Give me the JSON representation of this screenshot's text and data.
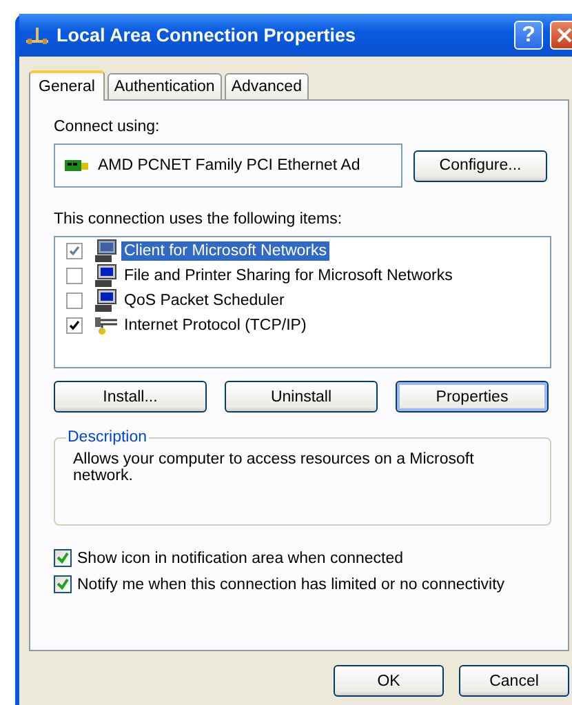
{
  "window": {
    "title": "Local Area Connection Properties",
    "help_button": "?"
  },
  "tabs": [
    {
      "label": "General",
      "selected": true
    },
    {
      "label": "Authentication",
      "selected": false
    },
    {
      "label": "Advanced",
      "selected": false
    }
  ],
  "connect_using": {
    "label": "Connect using:",
    "adapter": "AMD PCNET Family PCI Ethernet Ad",
    "button": "Configure..."
  },
  "items_label": "This connection uses the following items:",
  "items": [
    {
      "label": "Client for Microsoft Networks",
      "kind": "computer",
      "checked": true,
      "selected": true
    },
    {
      "label": "File and Printer Sharing for Microsoft Networks",
      "kind": "computer",
      "checked": false,
      "selected": false
    },
    {
      "label": "QoS Packet Scheduler",
      "kind": "computer",
      "checked": false,
      "selected": false
    },
    {
      "label": "Internet Protocol (TCP/IP)",
      "kind": "protocol",
      "checked": true,
      "selected": false
    }
  ],
  "item_buttons": [
    {
      "label": "Install...",
      "focused": false
    },
    {
      "label": "Uninstall",
      "focused": false
    },
    {
      "label": "Properties",
      "focused": true
    }
  ],
  "description": {
    "title": "Description",
    "text": "Allows your computer to access resources on a Microsoft network."
  },
  "options": [
    {
      "label": "Show icon in notification area when connected",
      "checked": true
    },
    {
      "label": "Notify me when this connection has limited or no connectivity",
      "checked": true
    }
  ],
  "buttons": [
    "OK",
    "Cancel"
  ]
}
